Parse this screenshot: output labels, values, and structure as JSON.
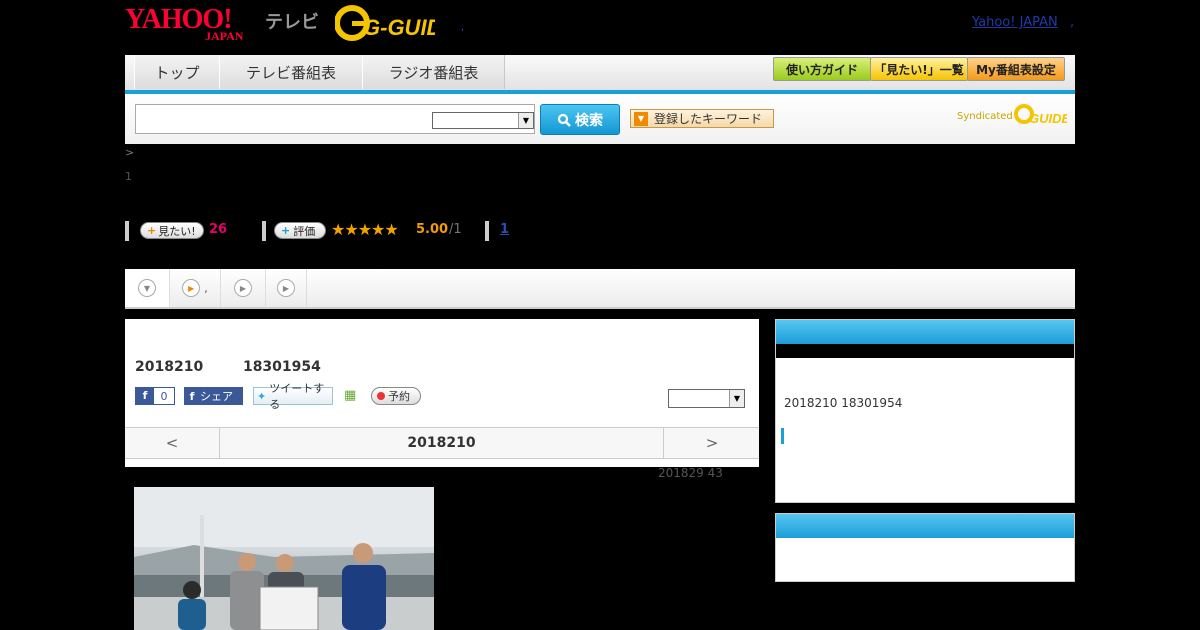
{
  "header": {
    "yahoo_logo": "YAHOO!",
    "yahoo_sub": "JAPAN",
    "tv_label": "テレビ",
    "gguide_logo": "G-GUIDE",
    "yahoo_japan_link": "Yahoo! JAPAN"
  },
  "nav": {
    "tabs": [
      "トップ",
      "テレビ番組表",
      "ラジオ番組表"
    ],
    "guide_btn": "使い方ガイド",
    "watchlist_btn": "「見たい!」一覧",
    "my_schedule_btn": "My番組表設定"
  },
  "search": {
    "button_label": "検索",
    "keyword_button": "登録したキーワード",
    "syndicated": "Syndicated"
  },
  "breadcrumb": ">",
  "page_number": "1",
  "stats": {
    "want_label": "見たい!",
    "want_count": "26",
    "rate_label": "評価",
    "stars": "★★★★★",
    "score": "5.00",
    "score_total": "/1",
    "review_count": "1"
  },
  "tabs": {
    "second_suffix": ","
  },
  "episode": {
    "date": "2018210",
    "time": "18301954",
    "fb_count": "0",
    "share_label": "シェア",
    "tweet_label": "ツイートする",
    "reserve_label": "予約",
    "prev": "<",
    "pager_date": "2018210",
    "next": ">",
    "meta": "201829  43"
  },
  "side": {
    "info": "2018210  18301954"
  },
  "colors": {
    "accent_blue": "#1aa0d8",
    "brand_red": "#ff0033",
    "gguide_yellow": "#f5c400",
    "count_pink": "#e4006b",
    "star_orange": "#f3a300"
  }
}
